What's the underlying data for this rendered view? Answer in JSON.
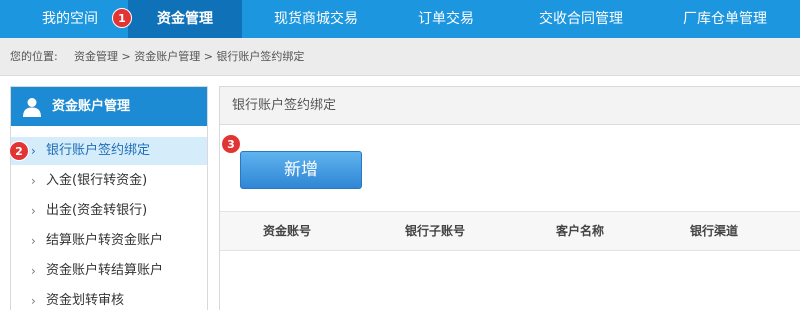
{
  "nav": {
    "tabs": [
      {
        "label": "我的空间"
      },
      {
        "label": "资金管理"
      },
      {
        "label": "现货商城交易"
      },
      {
        "label": "订单交易"
      },
      {
        "label": "交收合同管理"
      },
      {
        "label": "厂库仓单管理"
      }
    ]
  },
  "annotations": {
    "b1": "1",
    "b2": "2",
    "b3": "3"
  },
  "breadcrumb": {
    "prefix": "您的位置:",
    "path": "资金管理 > 资金账户管理 > 银行账户签约绑定"
  },
  "sidebar": {
    "title": "资金账户管理",
    "items": [
      {
        "label": "银行账户签约绑定"
      },
      {
        "label": "入金(银行转资金)"
      },
      {
        "label": "出金(资金转银行)"
      },
      {
        "label": "结算账户转资金账户"
      },
      {
        "label": "资金账户转结算账户"
      },
      {
        "label": "资金划转审核"
      }
    ]
  },
  "main": {
    "title": "银行账户签约绑定",
    "add_label": "新增",
    "columns": [
      "资金账号",
      "银行子账号",
      "客户名称",
      "银行渠道"
    ]
  },
  "icons": {
    "chevron": "›"
  },
  "colors": {
    "nav_bg": "#1b96df",
    "nav_active": "#0f71b8",
    "sidebar_head": "#1d8bd3",
    "badge": "#e33434"
  }
}
